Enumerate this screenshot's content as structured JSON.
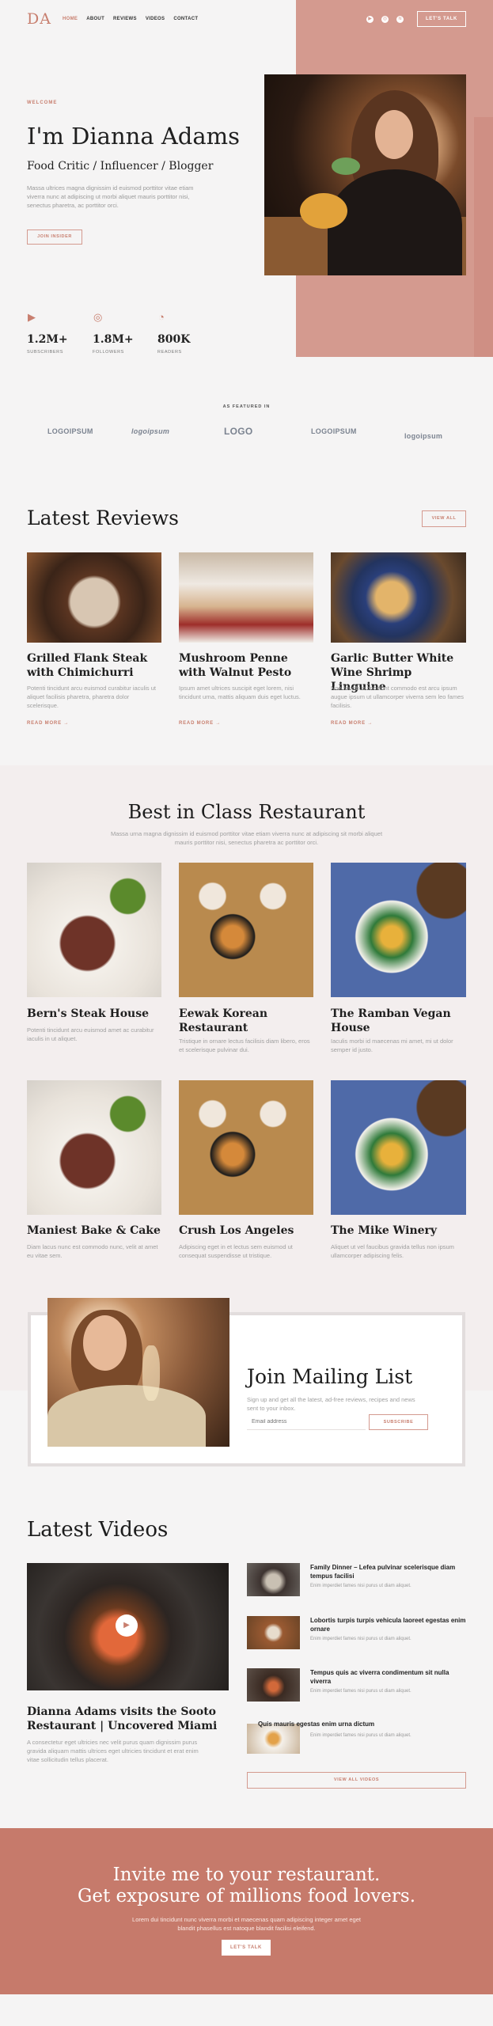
{
  "header": {
    "logo": "DA",
    "nav": [
      "HOME",
      "ABOUT",
      "REVIEWS",
      "VIDEOS",
      "CONTACT"
    ],
    "cta": "LET'S TALK",
    "social_icons": [
      "youtube-icon",
      "instagram-icon",
      "spotify-icon"
    ]
  },
  "hero": {
    "eyebrow": "WELCOME",
    "title": "I'm Dianna Adams",
    "subtitle": "Food Critic / Influencer / Blogger",
    "text": "Massa ultrices magna dignissim id euismod porttitor vitae etiam viverra nunc at adipiscing ut morbi aliquet mauris porttitor nisi, senectus pharetra, ac porttitor orci.",
    "button": "JOIN INSIDER"
  },
  "stats": [
    {
      "icon": "youtube-icon",
      "value": "1.2M+",
      "label": "SUBSCRIBERS"
    },
    {
      "icon": "instagram-icon",
      "value": "1.8M+",
      "label": "FOLLOWERS"
    },
    {
      "icon": "rss-icon",
      "value": "800K",
      "label": "READERS"
    }
  ],
  "featured": {
    "label": "AS FEATURED IN",
    "brands": [
      "LOGOIPSUM",
      "logoipsum",
      "LOGO",
      "LOGOIPSUM",
      "logoipsum"
    ]
  },
  "reviews": {
    "title": "Latest Reviews",
    "view_all": "VIEW ALL",
    "read_more": "READ MORE →",
    "items": [
      {
        "title": "Grilled Flank Steak with Chimichurri",
        "text": "Potenti tincidunt arcu euismod curabitur iaculis ut aliquet facilisis pharetra, pharetra dolor scelerisque."
      },
      {
        "title": "Mushroom Penne with Walnut Pesto",
        "text": "Ipsum amet ultrices suscipit eget lorem, nisi tincidunt urna, mattis aliquam duis eget luctus."
      },
      {
        "title": "Garlic Butter White Wine Shrimp Linguine",
        "text": "Non faucibus tincidunt commodo est arcu ipsum augue ipsum ut ullamcorper viverra sem leo fames facilisis."
      }
    ]
  },
  "restaurants": {
    "title": "Best in Class Restaurant",
    "text": "Massa urna magna dignissim id euismod porttitor vitae etiam viverra nunc at adipiscing sit morbi aliquet mauris porttitor nisi, senectus pharetra ac porttitor orci.",
    "items": [
      {
        "title": "Bern's Steak House",
        "text": "Potenti tincidunt arcu euismod amet ac curabitur iaculis in ut aliquet."
      },
      {
        "title": "Eewak Korean Restaurant",
        "text": "Tristique in ornare lectus facilisis diam libero, eros et scelerisque pulvinar dui."
      },
      {
        "title": "The Ramban Vegan House",
        "text": "Iaculis morbi id maecenas mi amet, mi ut dolor semper id justo."
      },
      {
        "title": "Maniest Bake & Cake",
        "text": "Diam lacus nunc est commodo nunc, velit at amet eu vitae sem."
      },
      {
        "title": "Crush Los Angeles",
        "text": "Adipiscing eget in et lectus sem euismod ut consequat suspendisse ut tristique."
      },
      {
        "title": "The Mike Winery",
        "text": "Aliquet ut vel faucibus gravida tellus non ipsum ullamcorper adipiscing felis."
      }
    ]
  },
  "mailing": {
    "title": "Join Mailing List",
    "text": "Sign up and get all the latest, ad-free reviews, recipes and news sent to your inbox.",
    "placeholder": "Email address",
    "button": "SUBSCRIBE"
  },
  "videos": {
    "title": "Latest Videos",
    "main_title": "Dianna Adams visits the Sooto Restaurant | Uncovered Miami",
    "main_text": "A consectetur eget ultricies nec velit purus quam dignissim purus gravida aliquam mattis ultrices eget ultricies tincidunt et erat enim vitae sollicitudin tellus placerat.",
    "list": [
      {
        "title": "Family Dinner – Lefea pulvinar scelerisque diam tempus facilisi",
        "text": "Enim imperdiet fames nisi purus ut diam aliquet."
      },
      {
        "title": "Lobortis turpis turpis vehicula laoreet egestas enim ornare",
        "text": "Enim imperdiet fames nisi purus ut diam aliquet."
      },
      {
        "title": "Tempus quis ac viverra condimentum sit nulla viverra",
        "text": "Enim imperdiet fames nisi purus ut diam aliquet."
      },
      {
        "title": "Quis mauris egestas enim urna dictum",
        "text": "Enim imperdiet fames nisi purus ut diam aliquet."
      }
    ],
    "view_all": "VIEW ALL VIDEOS"
  },
  "invite": {
    "title1": "Invite me to your restaurant.",
    "title2": "Get exposure of millions food lovers.",
    "text": "Lorem dui tincidunt nunc viverra morbi et maecenas quam adipiscing integer amet eget blandit phasellus est natoque blandit facilisi eleifend.",
    "button": "LET'S TALK"
  },
  "colors": {
    "accent": "#c87f6f",
    "hero_bg": "#d49a8f",
    "footer_band": "#c67a6b"
  }
}
